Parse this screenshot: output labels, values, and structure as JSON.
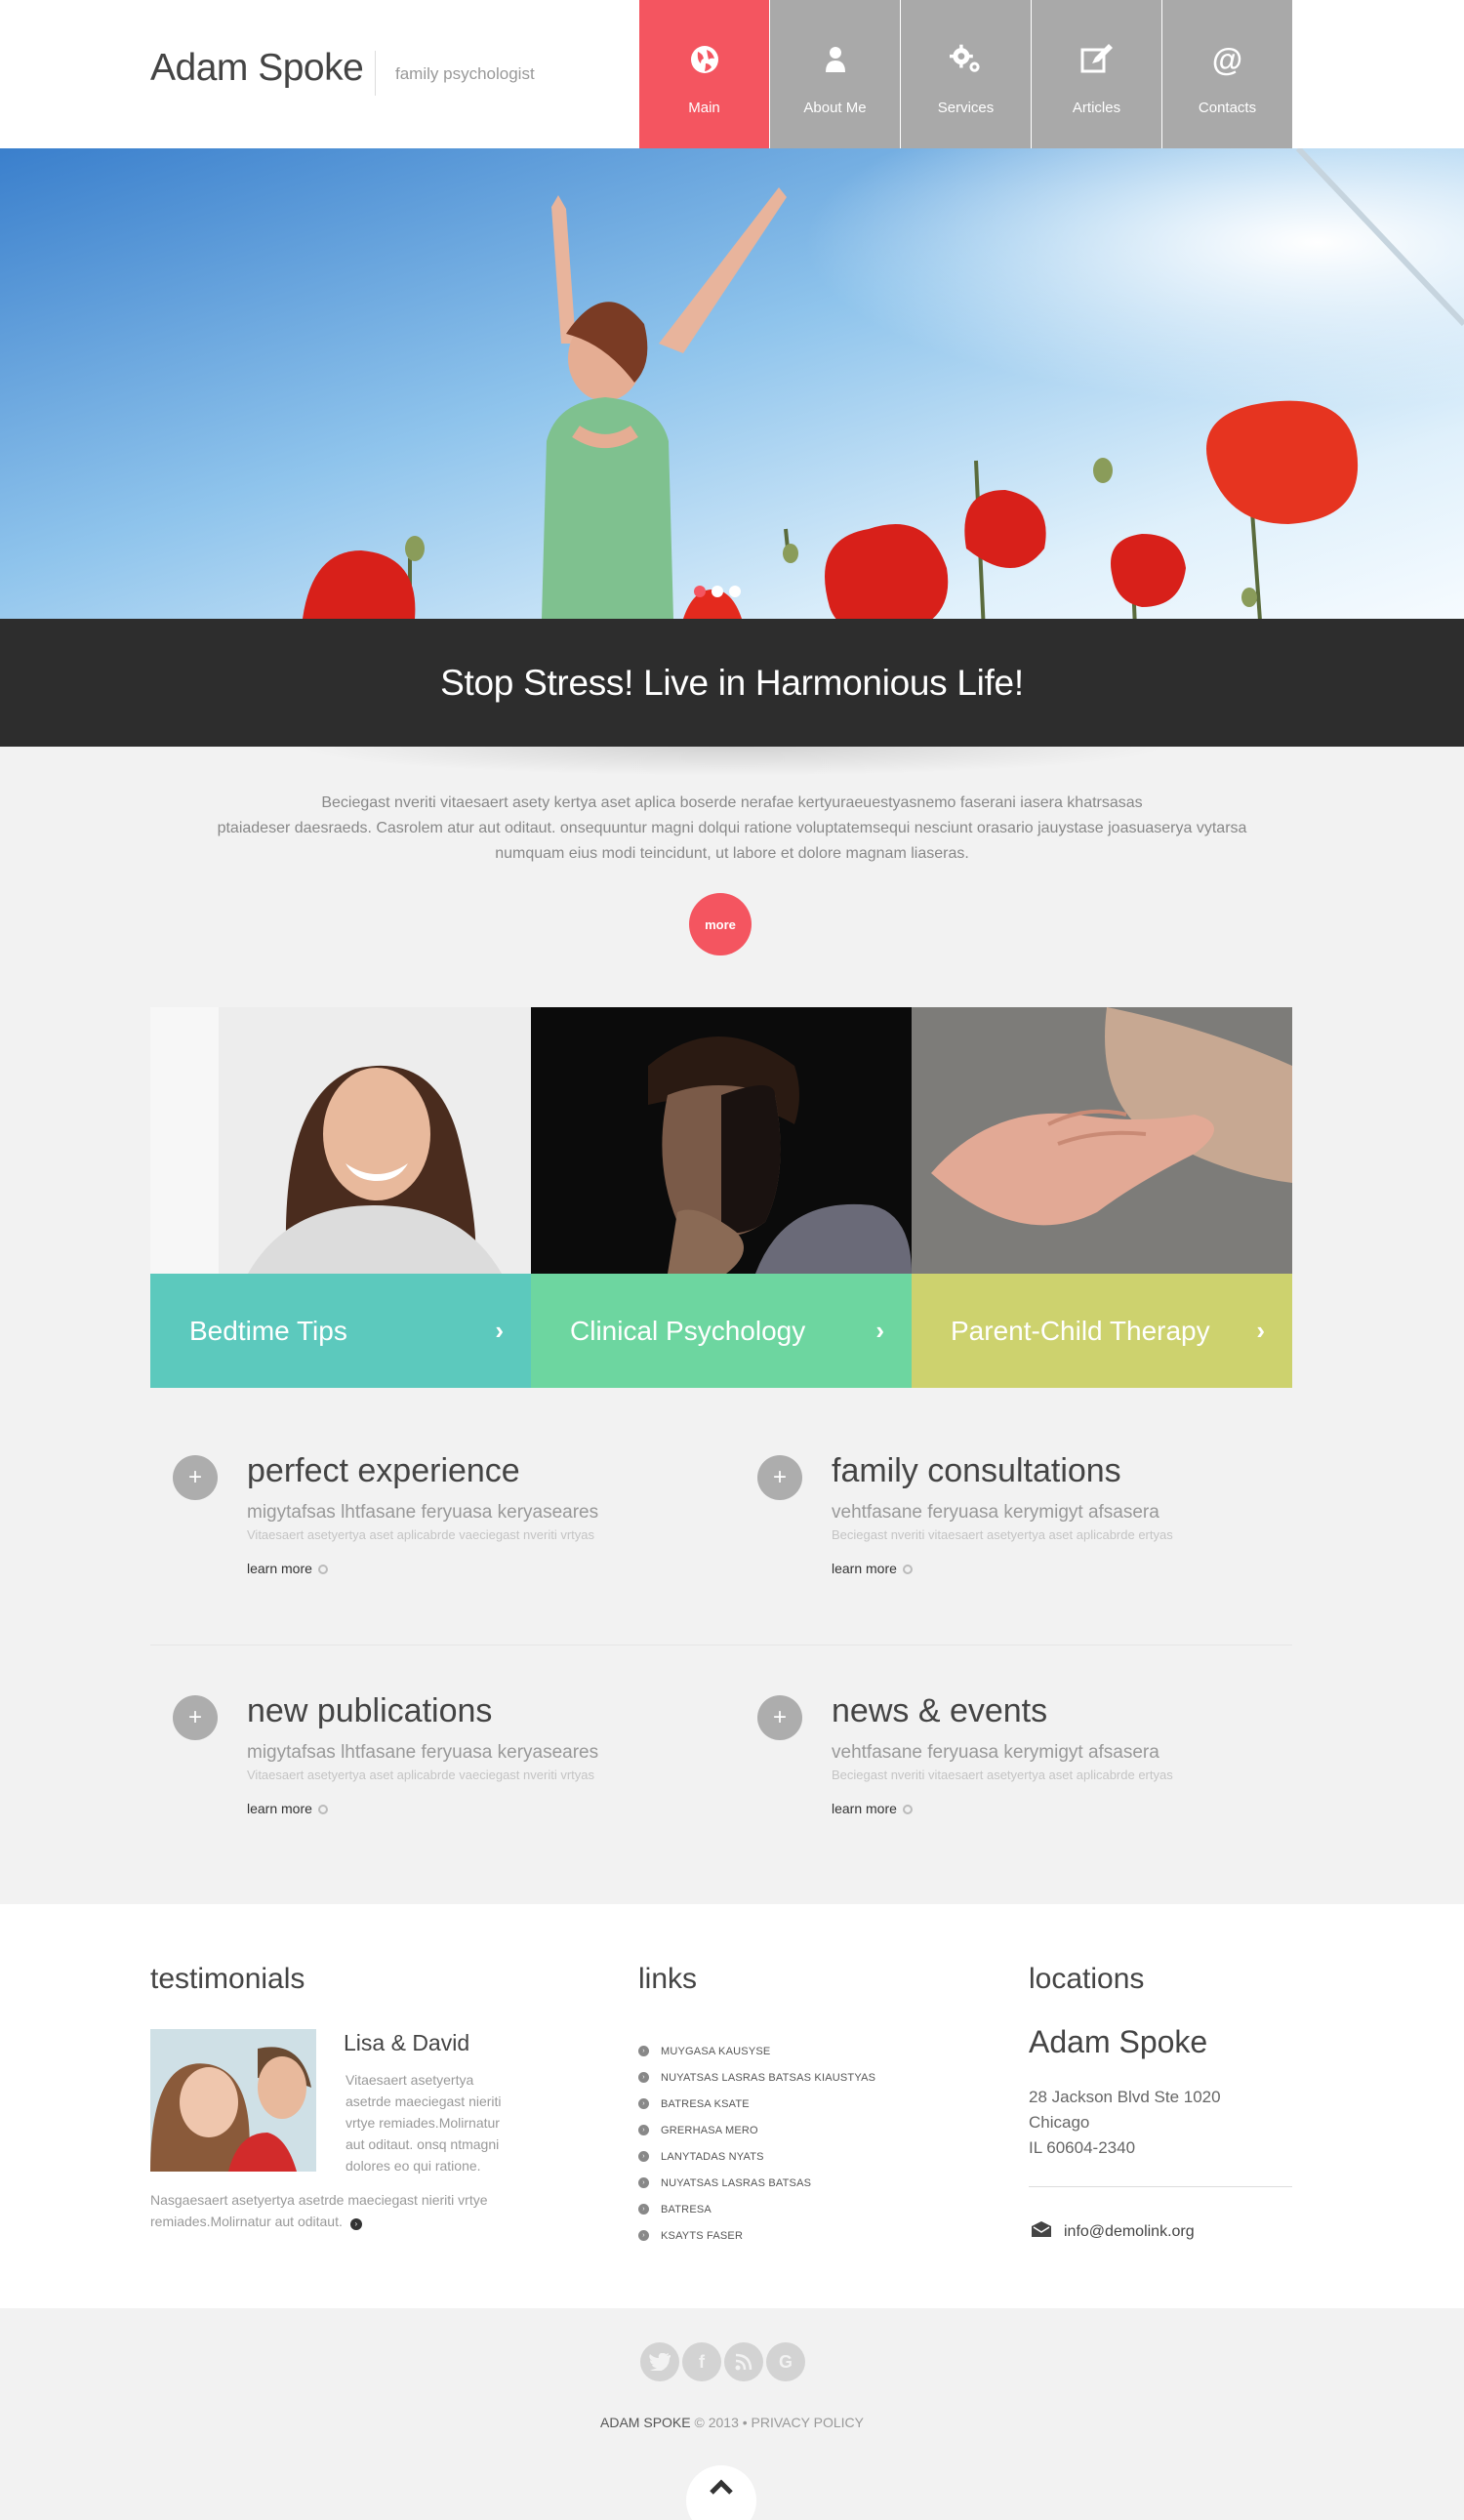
{
  "header": {
    "logo": "Adam Spoke",
    "tagline": "family psychologist",
    "nav": [
      {
        "label": "Main",
        "icon": "globe-icon",
        "active": true
      },
      {
        "label": "About Me",
        "icon": "person-icon",
        "active": false
      },
      {
        "label": "Services",
        "icon": "gears-icon",
        "active": false
      },
      {
        "label": "Articles",
        "icon": "edit-icon",
        "active": false
      },
      {
        "label": "Contacts",
        "icon": "at-icon",
        "active": false
      }
    ]
  },
  "colors": {
    "accent": "#f45560",
    "nav_gray": "#a9a9a9",
    "banner_dark": "#2d2d2d",
    "tile_teal": "#5cc9bd",
    "tile_green": "#6dd6a0",
    "tile_olive": "#cdd26e"
  },
  "hero": {
    "slides_count": 3,
    "active_slide": 1,
    "headline": "Stop Stress! Live in Harmonious Life!"
  },
  "intro": {
    "text_lines": [
      "Beciegast nveriti vitaesaert asety kertya aset aplica boserde nerafae kertyuraeuestyasnemo faserani  iasera khatrsasas",
      "ptaiadeser daesraeds. Casrolem atur aut oditaut. onsequuntur magni dolqui ratione voluptatemsequi nesciunt orasario jauystase joasuaserya vytarsa",
      "numquam eius modi teincidunt, ut labore et dolore magnam liaseras."
    ],
    "more_label": "more"
  },
  "tiles": [
    {
      "label": "Bedtime Tips",
      "arrow": "›"
    },
    {
      "label": "Clinical Psychology",
      "arrow": "›"
    },
    {
      "label": "Parent-Child Therapy",
      "arrow": "›"
    }
  ],
  "info_blocks": [
    {
      "plus": "+",
      "title": "perfect experience",
      "subtitle": "migytafsas lhtfasane feryuasa keryaseares",
      "text": "Vitaesaert asetyertya aset aplicabrde vaeciegast nveriti vrtyas",
      "link": "learn more"
    },
    {
      "plus": "+",
      "title": "family consultations",
      "subtitle": "vehtfasane feryuasa kerymigyt afsasera",
      "text": "Beciegast nveriti vitaesaert asetyertya aset aplicabrde ertyas",
      "link": "learn more"
    },
    {
      "plus": "+",
      "title": "new publications",
      "subtitle": "migytafsas lhtfasane feryuasa keryaseares",
      "text": "Vitaesaert asetyertya aset aplicabrde vaeciegast nveriti vrtyas",
      "link": "learn more"
    },
    {
      "plus": "+",
      "title": "news & events",
      "subtitle": "vehtfasane feryuasa kerymigyt afsasera",
      "text": "Beciegast nveriti vitaesaert asetyertya aset aplicabrde ertyas",
      "link": "learn more"
    }
  ],
  "testimonials": {
    "heading": "testimonials",
    "name": "Lisa & David",
    "text": "Vitaesaert asetyertya asetrde maeciegast nieriti vrtye remiades.Molirnatur aut oditaut. onsq ntmagni dolores eo qui ratione.",
    "more_text": "Nasgaesaert asetyertya asetrde maeciegast nieriti vrtye remiades.Molirnatur aut oditaut."
  },
  "links": {
    "heading": "links",
    "items": [
      "MUYGASA KAUSYSE",
      "NUYATSAS LASRAS BATSAS KIAUSTYAS",
      "BATRESA KSATE",
      "GRERHASA MERO",
      "LANYTADAS NYATS",
      "NUYATSAS LASRAS BATSAS",
      "BATRESA",
      "KSAYTS FASER"
    ]
  },
  "locations": {
    "heading": "locations",
    "name": "Adam Spoke",
    "address": [
      "28 Jackson Blvd Ste 1020",
      "Chicago",
      "IL 60604-2340"
    ],
    "email": "info@demolink.org"
  },
  "footer": {
    "social": [
      "twitter-icon",
      "facebook-icon",
      "rss-icon",
      "google-icon"
    ],
    "brand": "ADAM SPOKE",
    "copyright": "© 2013",
    "separator": "•",
    "privacy": "PRIVACY POLICY"
  }
}
